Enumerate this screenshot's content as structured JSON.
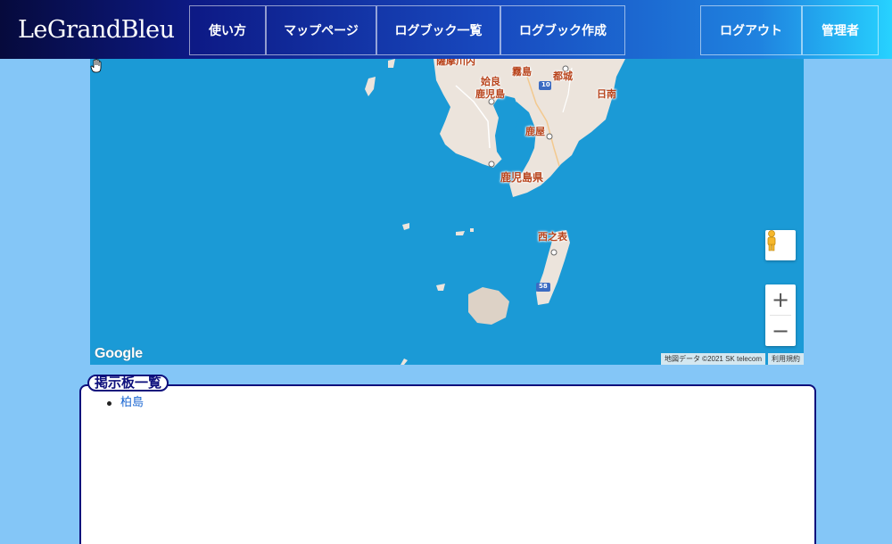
{
  "brand": {
    "name": "LeGrandBleu"
  },
  "nav": {
    "usage": "使い方",
    "map_page": "マップページ",
    "logbook_list": "ログブック一覧",
    "logbook_create": "ログブック作成",
    "logout": "ログアウト",
    "admin": "管理者"
  },
  "map": {
    "labels": {
      "satsumasendai": "薩摩川内",
      "kirishima": "霧島",
      "miyakonojo": "都城",
      "aira": "姶良",
      "kagoshima": "鹿児島",
      "nichinan": "日南",
      "kanoya": "鹿屋",
      "kagoshima_pref": "鹿児島県",
      "nishinoomote": "西之表",
      "route_10": "10",
      "route_58": "58"
    },
    "google_logo": "Google",
    "attribution": "地図データ ©2021 SK telecom",
    "terms": "利用規約",
    "zoom_in": "+",
    "zoom_out": "−",
    "colors": {
      "water": "#1b9ad6",
      "land": "#ede4dc"
    }
  },
  "board": {
    "title": "掲示板一覧",
    "items": [
      "柏島"
    ]
  }
}
